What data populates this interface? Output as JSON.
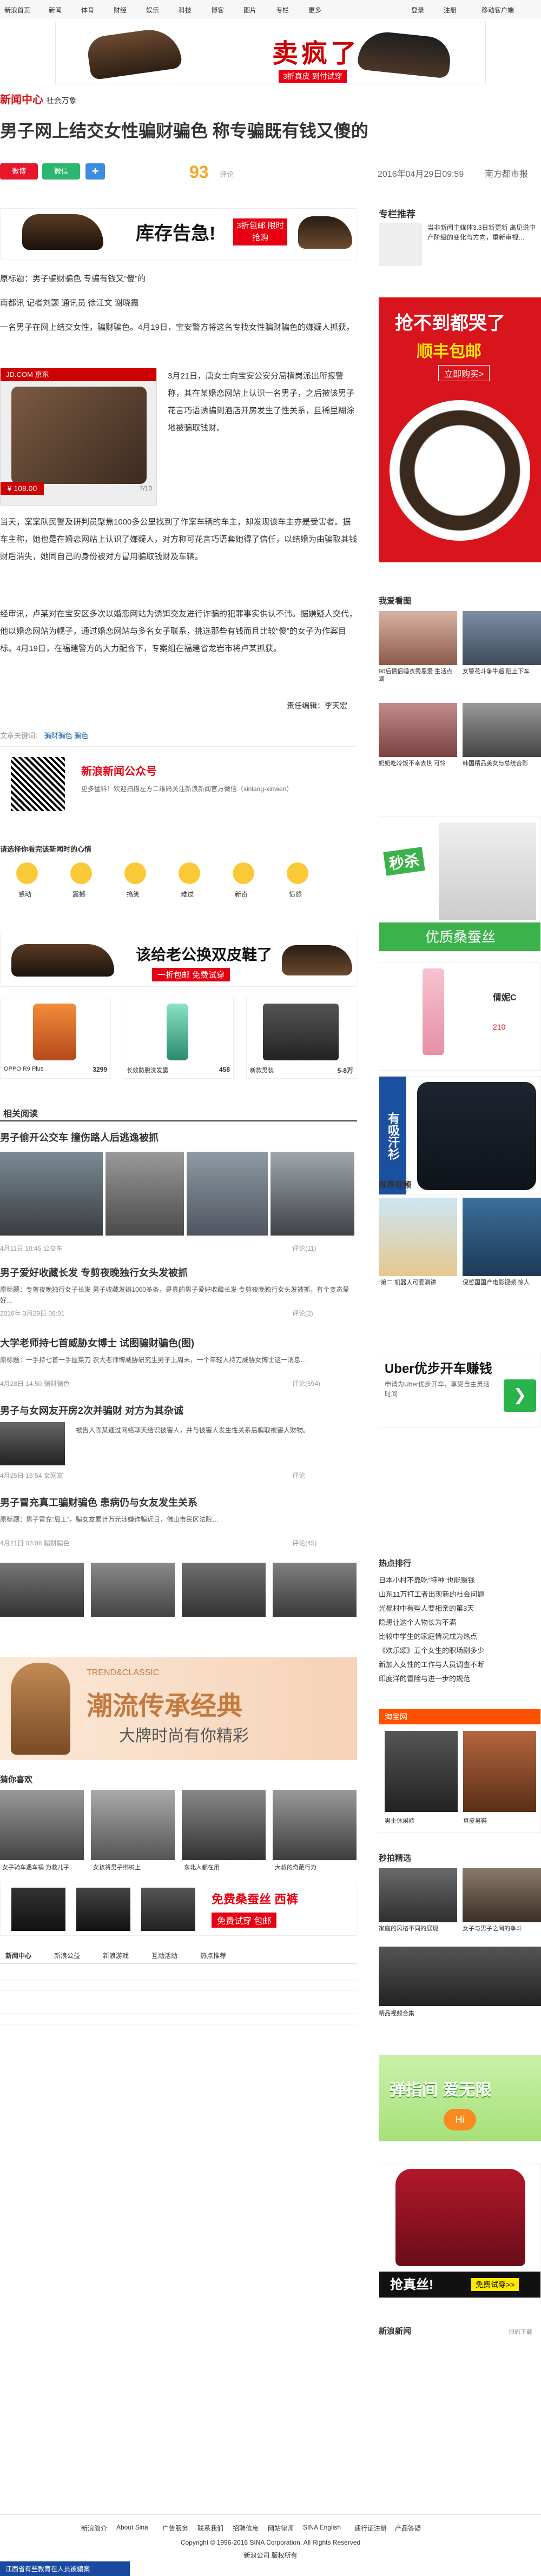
{
  "topnav": {
    "items": [
      "新浪首页",
      "新闻",
      "体育",
      "财经",
      "娱乐",
      "科技",
      "博客",
      "图片",
      "专栏",
      "更多"
    ],
    "right": [
      "登录",
      "注册",
      "移动客户端"
    ]
  },
  "top_ad": {
    "headline": "卖疯了",
    "sub": "3折真皮 到付试穿"
  },
  "logo": {
    "name": "新闻中心",
    "sub": "社会万象"
  },
  "article": {
    "title": "男子网上结交女性骗财骗色 称专骗既有钱又傻的",
    "share": {
      "weibo": "微博",
      "weixin": "微信",
      "plus": "+"
    },
    "comments": "93",
    "comments_label": "评论",
    "datetime": "2016年04月29日09:59",
    "source": "南方都市报",
    "paragraphs": [
      "原标题：男子骗财骗色 专骗有钱又“傻”的",
      "南都讯 记者刘颢 通讯员 徐江文 谢晓霞",
      "一名男子在网上结交女性，骗财骗色。4月19日，宝安警方将这名专找女性骗财骗色的嫌疑人抓获。",
      "3月21日，唐女士向宝安公安分局横岗派出所报警称，其在某婚恋网站上认识一名男子，之后被该男子花言巧语诱骗到酒店开房发生了性关系，且稀里糊涂地被骗取钱财。",
      "当天，案案队民警及研判员聚焦1000多公里找到了作案车辆的车主，却发现该车主亦是受害者。据车主称，她也是在婚恋网站上认识了嫌疑人，对方称可花言巧语套她得了信任，以结婚为由骗取其钱财后消失，她同自己的身份被对方冒用骗取钱财及车辆。",
      "经审讯，卢某对在宝安区多次以婚恋网站为诱饵交友进行诈骗的犯罪事实供认不讳。据嫌疑人交代，他以婚恋网站为幌子，通过婚恋网站与多名女子联系，挑选那些有钱而且比较“傻”的女子为作案目标。4月19日，在福建警方的大力配合下，专案组在福建省龙岩市将卢某抓获。"
    ],
    "editor": "责任编辑：李天宏",
    "keywords_label": "文章关键词：",
    "keywords": "骗财骗色 骗色"
  },
  "inset_ad": {
    "brand": "JD.COM 京东",
    "price": "¥ 108.00",
    "badge": "7/10"
  },
  "inv_ad": {
    "title": "库存告急!",
    "badge": "3折包邮 限时抢购"
  },
  "wechat": {
    "title": "新浪新闻公众号",
    "desc": "更多猛料！欢迎扫描左方二维码关注新浪新闻官方微信（xinlang-xinwen）"
  },
  "moods": {
    "title": "请选择你看完该新闻时的心情",
    "items": [
      "感动",
      "震撼",
      "搞笑",
      "难过",
      "新奇",
      "愤怒"
    ]
  },
  "shoe_ad": {
    "text": "该给老公换双皮鞋了",
    "sub": "一折包邮 免费试穿"
  },
  "products": [
    {
      "name": "OPPO R9 Plus",
      "price": "3299"
    },
    {
      "name": "长效防脱洗发露",
      "price": "458"
    },
    {
      "name": "新款男装",
      "price": "5-8万"
    }
  ],
  "related": {
    "title": "相关阅读",
    "items": [
      {
        "title": "男子偷开公交车 撞伤路人后逃逸被抓",
        "meta": "4月11日 10:45  公交车",
        "comments": "评论(11)"
      },
      {
        "title": "男子爱好收藏长发 专剪夜晚独行女头发被抓",
        "summary": "原标题：专剪夜晚独行女子长发 男子收藏发辫1000多条，是真的男子爱好收藏长发 专剪夜晚独行女头发被抓，有个变态爱好…",
        "meta": "2016年 3月29日 08:01",
        "comments": "评论(2)"
      },
      {
        "title": "大学老师持七首威胁女博士 试图骗财骗色(图)",
        "summary": "原标题：一手持七首一手握菜刀 农大老师博威胁研究生男子上周末，一个年轻人持刀威胁女博士这一消息…",
        "meta": "4月28日 14:50  骗财骗色",
        "comments": "评论(594)"
      },
      {
        "title": "男子与女网友开房2次并骗财 对方为其杂诚",
        "summary": "被告人陈某通过网络聊天结识被害人，并与被害人发生性关系后骗取被害人财物。",
        "meta": "4月25日 16:54  女网友",
        "comments": "评论"
      },
      {
        "title": "男子冒充真工骗财骗色 患病仍与女友发生关系",
        "summary": "原标题：男子冒充“局工”，骗女友累计万元涉嫌诈骗近日，佛山市民区法院…",
        "meta": "4月21日 03:08  骗财骗色",
        "comments": "评论(45)"
      }
    ]
  },
  "trend_ad": {
    "title": "潮流传承经典",
    "sub": "大牌时尚有你精彩",
    "en": "TREND&CLASSIC"
  },
  "pics": {
    "title": "猜你喜欢",
    "labels": [
      "女子骑车遇车祸 为救儿子",
      "女孩将男子绑树上",
      "东北人都在用",
      "大叔的奇葩行为"
    ]
  },
  "belt_ad": {
    "title": "免费试穿 包邮",
    "sub": "免费桑蚕丝 西裤"
  },
  "bottom_tabs": {
    "items": [
      "新闻中心",
      "新浪公益",
      "新浪游戏",
      "互动活动",
      "热点推荐"
    ]
  },
  "sidebar": {
    "rec_title": "专栏推荐",
    "rec_text": "当非新闻主媒体3.3日新更新 离见说中产阶级的变化与方向，重新审视…",
    "belt_title": "抢不到都哭了",
    "belt_sub": "顺丰包邮",
    "belt_btn": "立即购买>",
    "watch_title": "我爱看图",
    "watch_items": [
      "90后情侣睡衣秀恩爱 生活点滴",
      "女警花斗争牛逼 阻止下车",
      "奶奶吃冷饭不幸去世 可怜",
      "韩国精品美女与总统合影"
    ],
    "silk_title": "秒杀",
    "silk_sub": "优质桑蚕丝",
    "cosmetic_title": "倩妮C",
    "cosmetic_price": "210",
    "polo_title": "有吸汗衫",
    "video_title": "推荐视频",
    "video_items": [
      "“第二”机器人可爱演讲",
      "倪哲国国产电影视频 惊人"
    ],
    "uber_title": "Uber优步开车赚钱",
    "uber_sub": "申请为Uber优步开车，享受自主灵活时间",
    "hot_title": "热点排行",
    "hot_items": [
      "日本小村不靠吃“特种”也能赚钱",
      "山东11万打工者出现新的社会问题",
      "光棍村中有些人要相亲的第3天",
      "隐患让这个人物长为不满",
      "比较中学生的家庭情况成为热点",
      "《欢乐颂》五个女生的职场剧多少",
      "新加入女性的工作与人员调查不断",
      "印度洋的冒险与进一步的规范"
    ],
    "taobao_title": "淘宝网",
    "taobao_items": [
      "男士休闲裤",
      "真皮男鞋"
    ],
    "sec_title": "秒拍精选",
    "sec_items": [
      "家庭的风格不同的展现",
      "女子与男子之间的争斗",
      "精品视频合集"
    ],
    "app_title": "弹指间 爱无限",
    "app_btn": "Hi",
    "polo2_title": "抢真丝!",
    "polo2_btn": "免费试穿>>",
    "news_title": "新浪新闻",
    "news_sub": "扫码下载"
  },
  "footer": {
    "links": [
      "新浪简介",
      "About Sina",
      "广告服务",
      "联系我们",
      "招聘信息",
      "网站律师",
      "SINA English",
      "通行证注册",
      "产品答疑"
    ],
    "copyright": "Copyright © 1996-2016 SINA Corporation, All Rights Reserved",
    "company": "新浪公司 版权所有",
    "bottom_ad": "江西省有些教育在人员被骗案"
  }
}
